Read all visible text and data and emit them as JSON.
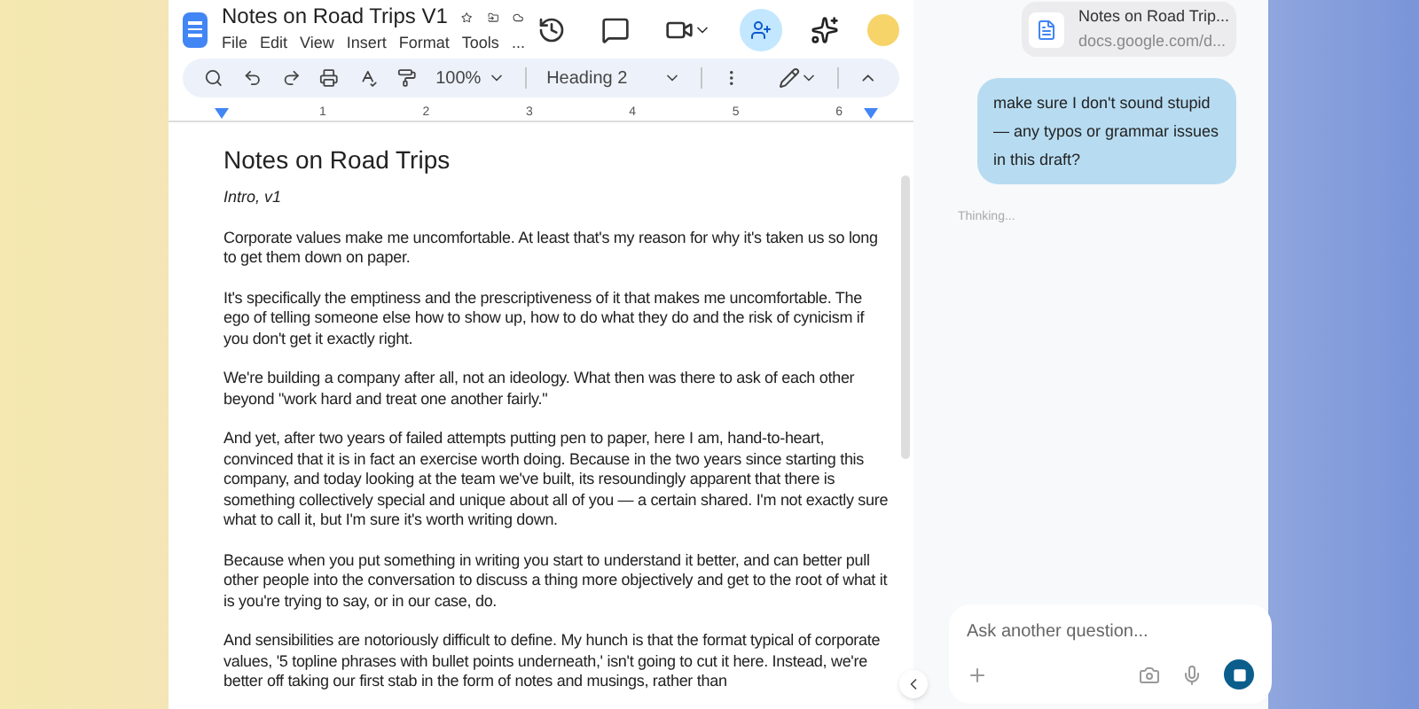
{
  "docs": {
    "title": "Notes on Road Trips V1",
    "menu": [
      "File",
      "Edit",
      "View",
      "Insert",
      "Format",
      "Tools",
      "..."
    ],
    "toolbar": {
      "zoom": "100%",
      "style": "Heading 2"
    },
    "ruler": [
      "1",
      "2",
      "3",
      "4",
      "5",
      "6"
    ],
    "document": {
      "heading": "Notes on Road Trips",
      "subtitle": "Intro, v1",
      "paragraphs": [
        "Corporate values make me uncomfortable. At least that's my reason for why it's taken us so long to get them down on paper.",
        "It's specifically the emptiness and the prescriptiveness of it that makes me uncomfortable. The ego of telling someone else how to show up, how to do what they do and the risk of cynicism if you don't get it exactly right.",
        "We're building a company after all, not an ideology. What then was there to ask of each other beyond \"work hard and treat one another fairly.\"",
        "And yet, after two years of failed attempts putting pen to paper, here I am, hand-to-heart, convinced that it is in fact an exercise worth doing. Because in the two years since starting this company, and today looking at the team we've built, its resoundingly apparent that there is something collectively special and unique about all of you — a certain shared. I'm not exactly sure what to call it, but I'm sure it's worth writing down.",
        "Because when you put something in writing you start to understand it better, and can better pull other people into the conversation to discuss a thing more objectively and get to the root of what it is you're trying to say, or in our case, do.",
        "And sensibilities are notoriously difficult to define. My hunch is that the format typical of corporate values, '5 topline phrases with bullet points underneath,' isn't going to cut it here. Instead, we're better off taking our first stab in the form of notes and musings, rather than"
      ]
    }
  },
  "chat": {
    "attachment": {
      "title": "Notes on Road Trip...",
      "url": "docs.google.com/d..."
    },
    "user_message": "make sure I don't sound stupid — any typos or grammar issues in this draft?",
    "status": "Thinking...",
    "input": {
      "placeholder": "Ask another question..."
    }
  }
}
